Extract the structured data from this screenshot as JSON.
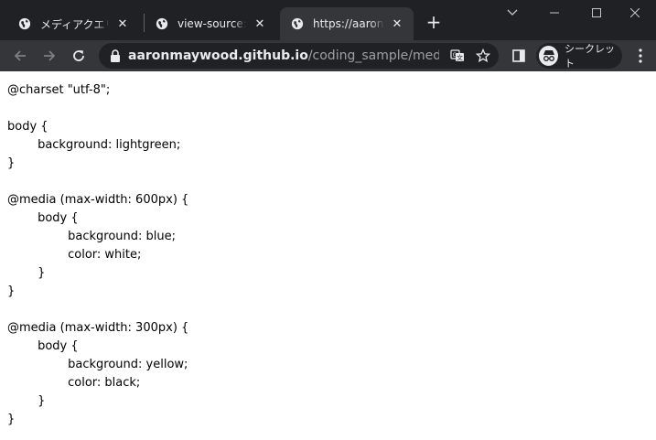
{
  "tabs": [
    {
      "title": "メディアクエリー",
      "close": "✕"
    },
    {
      "title": "view-source:https://aaronmaywood.github.io",
      "close": "✕"
    },
    {
      "title": "https://aaronmaywood.github.io",
      "close": "✕"
    }
  ],
  "new_tab": "+",
  "address_bar": {
    "host": "aaronmaywood.github.io",
    "path": "/coding_sample/media-que..."
  },
  "profile": {
    "label": "シークレット"
  },
  "colors": {
    "frame": "#202124",
    "toolbar": "#35363a",
    "text": "#e8eaed",
    "muted": "#9aa0a6"
  },
  "source_code": "@charset \"utf-8\";\n\nbody {\n\tbackground: lightgreen;\n}\n\n@media (max-width: 600px) {\n\tbody {\n\t\tbackground: blue;\n\t\tcolor: white;\n\t}\n}\n\n@media (max-width: 300px) {\n\tbody {\n\t\tbackground: yellow;\n\t\tcolor: black;\n\t}\n}"
}
